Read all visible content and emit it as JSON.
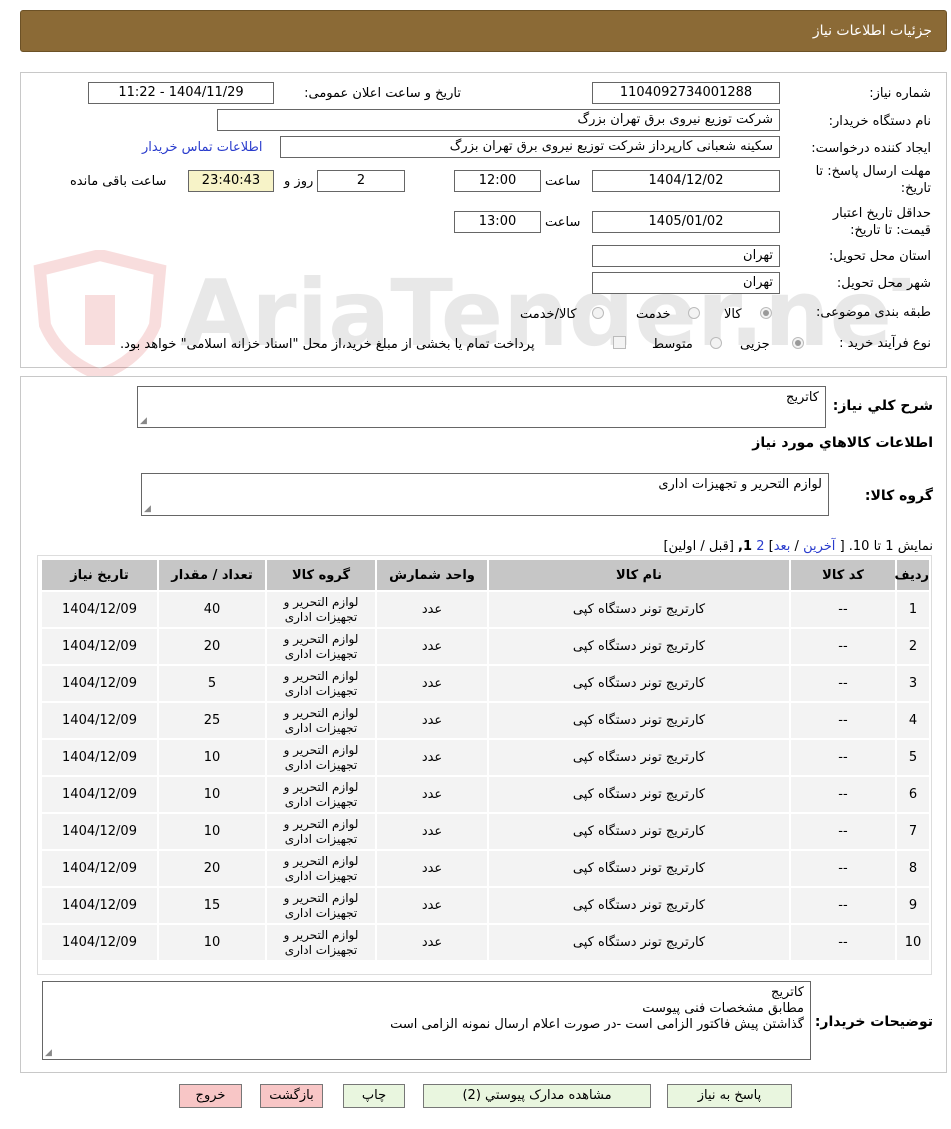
{
  "header": {
    "title": "جزئیات اطلاعات نیاز"
  },
  "form": {
    "need_number_label": "شماره نیاز:",
    "need_number": "1104092734001288",
    "announce_label": "تاریخ و ساعت اعلان عمومی:",
    "announce_value": "1404/11/29 - 11:22",
    "buyer_label": "نام دستگاه خریدار:",
    "buyer_value": "شرکت توزیع نیروی برق تهران بزرگ",
    "creator_label": "ایجاد کننده درخواست:",
    "creator_value": "سکینه شعبانی کارپرداز شرکت توزیع نیروی برق تهران بزرگ",
    "contact_link": "اطلاعات تماس خریدار",
    "deadline_label_1": "مهلت ارسال پاسخ: تا",
    "deadline_label_2": "تاریخ:",
    "deadline_date": "1404/12/02",
    "time_label": "ساعت",
    "deadline_time": "12:00",
    "days_value": "2",
    "days_label": "روز و",
    "countdown_value": "23:40:43",
    "remaining_label": "ساعت باقی مانده",
    "validity_label_1": "حداقل تاریخ اعتبار",
    "validity_label_2": "قیمت: تا تاریخ:",
    "validity_date": "1405/01/02",
    "validity_time": "13:00",
    "province_label": "استان محل تحویل:",
    "province_value": "تهران",
    "city_label": "شهر محل تحویل:",
    "city_value": "تهران",
    "category_label": "طبقه بندی موضوعی:",
    "category_options": [
      "کالا",
      "خدمت",
      "کالا/خدمت"
    ],
    "process_label": "نوع فرآیند خرید :",
    "process_options": [
      "جزیی",
      "متوسط"
    ],
    "payment_note": "پرداخت تمام یا بخشی از مبلغ خرید،از محل \"اسناد خزانه اسلامی\" خواهد بود."
  },
  "details": {
    "summary_label": "شرح کلي نياز:",
    "summary_value": "کاتریج",
    "goods_info_title": "اطلاعات کالاهاي مورد نياز",
    "goods_group_label": "گروه کالا:",
    "goods_group_value": "لوازم التحریر و تجهیزات اداری",
    "pagination_prefix": "نمایش 1 تا 10. [",
    "pagination_last": "آخرین",
    "pagination_sep": "/",
    "pagination_next": "بعد",
    "pagination_close": "]",
    "pagination_page2": "2",
    "pagination_current": "1,",
    "pagination_rest": "[قبل / اولین]"
  },
  "table": {
    "headers": [
      "ردیف",
      "کد کالا",
      "نام کالا",
      "واحد شمارش",
      "گروه کالا",
      "تعداد / مقدار",
      "تاریخ نیاز"
    ],
    "rows": [
      {
        "n": "1",
        "code": "--",
        "name": "کارتریج تونر دستگاه کپی",
        "unit": "عدد",
        "g1": "لوازم التحریر و",
        "g2": "تجهیزات اداری",
        "qty": "40",
        "date": "1404/12/09"
      },
      {
        "n": "2",
        "code": "--",
        "name": "کارتریج تونر دستگاه کپی",
        "unit": "عدد",
        "g1": "لوازم التحریر و",
        "g2": "تجهیزات اداری",
        "qty": "20",
        "date": "1404/12/09"
      },
      {
        "n": "3",
        "code": "--",
        "name": "کارتریج تونر دستگاه کپی",
        "unit": "عدد",
        "g1": "لوازم التحریر و",
        "g2": "تجهیزات اداری",
        "qty": "5",
        "date": "1404/12/09"
      },
      {
        "n": "4",
        "code": "--",
        "name": "کارتریج تونر دستگاه کپی",
        "unit": "عدد",
        "g1": "لوازم التحریر و",
        "g2": "تجهیزات اداری",
        "qty": "25",
        "date": "1404/12/09"
      },
      {
        "n": "5",
        "code": "--",
        "name": "کارتریج تونر دستگاه کپی",
        "unit": "عدد",
        "g1": "لوازم التحریر و",
        "g2": "تجهیزات اداری",
        "qty": "10",
        "date": "1404/12/09"
      },
      {
        "n": "6",
        "code": "--",
        "name": "کارتریج تونر دستگاه کپی",
        "unit": "عدد",
        "g1": "لوازم التحریر و",
        "g2": "تجهیزات اداری",
        "qty": "10",
        "date": "1404/12/09"
      },
      {
        "n": "7",
        "code": "--",
        "name": "کارتریج تونر دستگاه کپی",
        "unit": "عدد",
        "g1": "لوازم التحریر و",
        "g2": "تجهیزات اداری",
        "qty": "10",
        "date": "1404/12/09"
      },
      {
        "n": "8",
        "code": "--",
        "name": "کارتریج تونر دستگاه کپی",
        "unit": "عدد",
        "g1": "لوازم التحریر و",
        "g2": "تجهیزات اداری",
        "qty": "20",
        "date": "1404/12/09"
      },
      {
        "n": "9",
        "code": "--",
        "name": "کارتریج تونر دستگاه کپی",
        "unit": "عدد",
        "g1": "لوازم التحریر و",
        "g2": "تجهیزات اداری",
        "qty": "15",
        "date": "1404/12/09"
      },
      {
        "n": "10",
        "code": "--",
        "name": "کارتریج تونر دستگاه کپی",
        "unit": "عدد",
        "g1": "لوازم التحریر و",
        "g2": "تجهیزات اداری",
        "qty": "10",
        "date": "1404/12/09"
      }
    ]
  },
  "buyer_notes": {
    "label": "توضیحات خریدار:",
    "lines": [
      "کاتریج",
      "مطابق مشخصات فنی پیوست",
      "گذاشتن پیش فاکتور الزامی است -در صورت اعلام ارسال نمونه الزامی است"
    ]
  },
  "buttons": {
    "reply": "پاسخ به نیاز",
    "attachments": "مشاهده مدارک پیوستي (2)",
    "print": "چاپ",
    "back": "بازگشت",
    "exit": "خروج"
  },
  "watermark": {
    "text": "AriaTender.neT"
  },
  "colors": {
    "header_bg": "#8b6a36",
    "link": "#2a3ccd",
    "countdown_bg": "#f7f3c8",
    "button_green": "#e9f6df",
    "button_red": "#f8c6c6"
  }
}
